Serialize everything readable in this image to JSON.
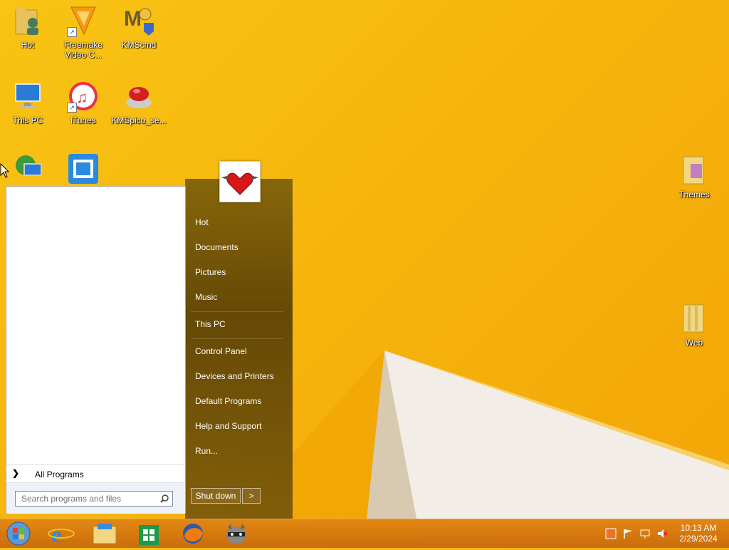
{
  "desktop": {
    "icons": [
      {
        "name": "Hot",
        "icon": "user-folder-icon"
      },
      {
        "name": "Freemake\nVideo C...",
        "icon": "freemake-icon"
      },
      {
        "name": "KMScmd",
        "icon": "kmscmd-icon"
      },
      {
        "name": "This PC",
        "icon": "computer-icon"
      },
      {
        "name": "iTunes",
        "icon": "itunes-icon"
      },
      {
        "name": "KMSpico_se...",
        "icon": "kmspico-icon"
      },
      {
        "name": "",
        "icon": "network-icon"
      },
      {
        "name": "",
        "icon": "maxthon-icon"
      },
      {
        "name": "Themes",
        "icon": "folder-icon"
      },
      {
        "name": "Web",
        "icon": "folder-icon"
      }
    ]
  },
  "start_menu": {
    "all_programs": "All Programs",
    "search_placeholder": "Search programs and files",
    "right_items": [
      "Hot",
      "Documents",
      "Pictures",
      "Music",
      "This PC",
      "Control Panel",
      "Devices and Printers",
      "Default Programs",
      "Help and Support",
      "Run..."
    ],
    "shutdown_label": "Shut down",
    "shutdown_arrow": ">",
    "user_picture": "winged-heart-icon"
  },
  "taskbar": {
    "buttons": [
      "start-orb-icon",
      "internet-explorer-icon",
      "file-explorer-icon",
      "store-icon",
      "firefox-icon",
      "raccoon-app-icon"
    ],
    "tray": [
      "ime-icon",
      "action-center-flag-icon",
      "network-tray-icon",
      "volume-muted-icon"
    ],
    "time": "10:13 AM",
    "date": "2/29/2024"
  },
  "colors": {
    "wallpaper": "#f6b50d",
    "taskbar": "#d97a14",
    "menu_right": "#6b4e08"
  }
}
